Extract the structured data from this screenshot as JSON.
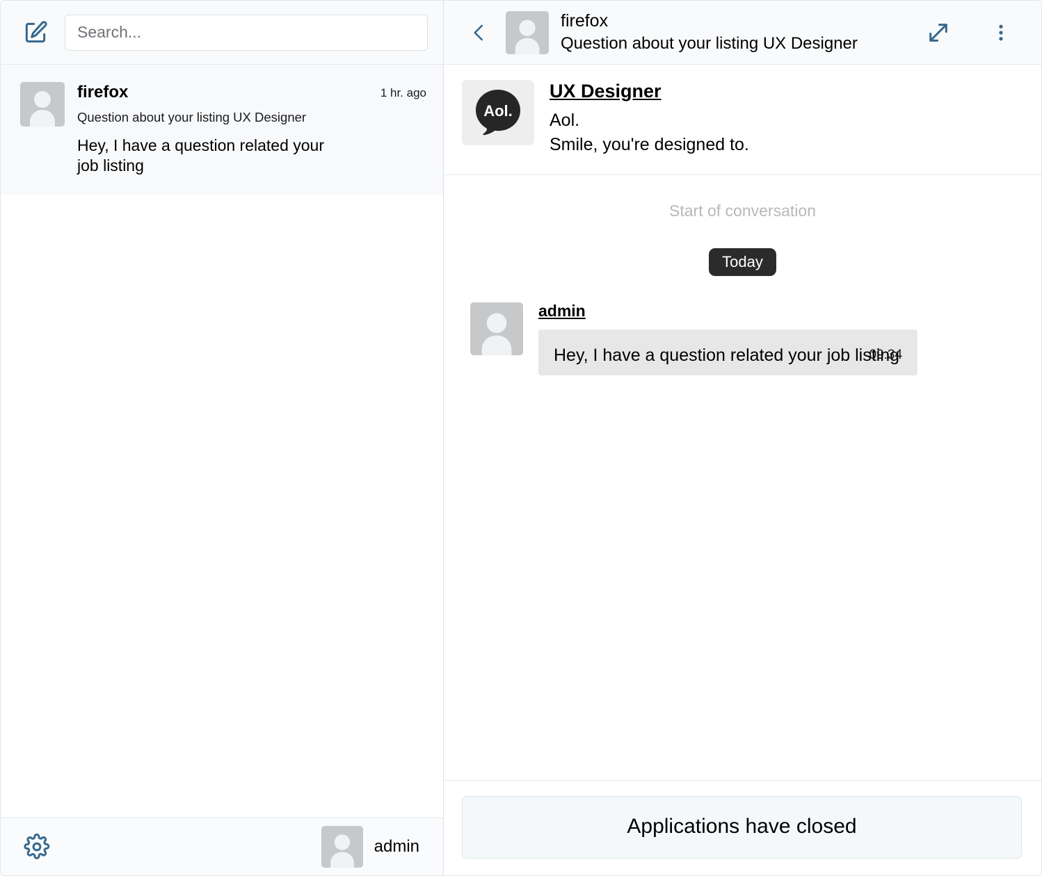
{
  "colors": {
    "accent": "#36688d",
    "panel_bg": "#f9fafb",
    "selected_item_bg": "#f8f9fb",
    "bubble_bg": "#e7e7e7",
    "day_pill_bg": "#2b2b2b",
    "banner_bg": "#f4f8fa",
    "avatar_bg": "#c6c8ca",
    "muted_text": "#b6b8ba"
  },
  "sidebar": {
    "compose_icon": "compose-icon",
    "search": {
      "placeholder": "Search...",
      "value": ""
    },
    "conversations": [
      {
        "avatar": "user-avatar",
        "name": "firefox",
        "time": "1 hr. ago",
        "subject": "Question about your listing UX Designer",
        "preview": "Hey, I have a question related your job listing",
        "selected": true
      }
    ],
    "footer": {
      "settings_icon": "gear-icon",
      "user_name": "admin",
      "user_avatar": "user-avatar"
    }
  },
  "chat": {
    "header": {
      "back_icon": "chevron-left-icon",
      "avatar": "user-avatar",
      "name": "firefox",
      "subject": "Question about your listing UX Designer",
      "expand_icon": "expand-diagonal-icon",
      "more_icon": "more-vertical-icon"
    },
    "listing": {
      "logo_text": "Aol.",
      "logo_name": "aol-logo",
      "title": "UX Designer",
      "company": "Aol.",
      "tagline": "Smile, you're designed to."
    },
    "start_label": "Start of conversation",
    "day_label": "Today",
    "messages": [
      {
        "avatar": "user-avatar",
        "author": "admin",
        "text": "Hey, I have a question related your job listing",
        "time": "09:34"
      }
    ],
    "composer": {
      "closed_notice": "Applications have closed"
    }
  }
}
